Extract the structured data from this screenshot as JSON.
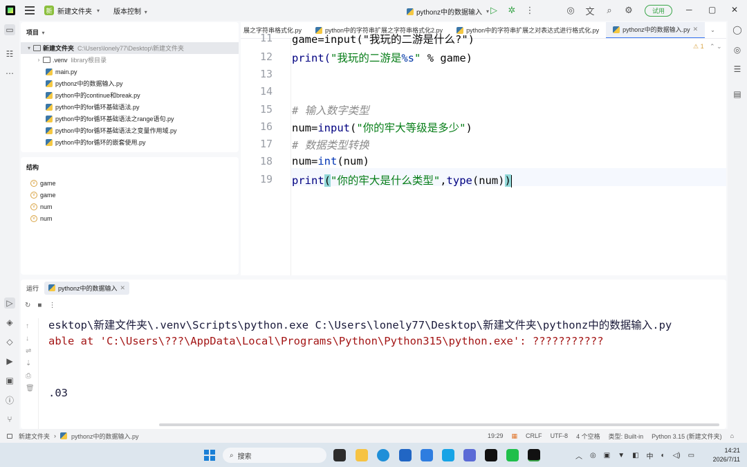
{
  "titlebar": {
    "project_name": "新建文件夹",
    "vcs_label": "版本控制",
    "run_config": "pythonz中的数据输入",
    "trial_label": "试用"
  },
  "project_panel": {
    "title": "项目",
    "root": {
      "name": "新建文件夹",
      "path": "C:\\Users\\lonely77\\Desktop\\新建文件夹"
    },
    "items": [
      {
        "name": ".venv",
        "note": "library根目录",
        "type": "folder"
      },
      {
        "name": "main.py",
        "type": "file"
      },
      {
        "name": "pythonz中的数据输入.py",
        "type": "file"
      },
      {
        "name": "python中的continue和break.py",
        "type": "file"
      },
      {
        "name": "python中的for循环基础语法.py",
        "type": "file"
      },
      {
        "name": "python中的for循环基础语法之range语句.py",
        "type": "file"
      },
      {
        "name": "python中的for循环基础语法之变量作用域.py",
        "type": "file"
      },
      {
        "name": "python中的for循环的嵌套使用.py",
        "type": "file"
      }
    ]
  },
  "structure_panel": {
    "title": "结构",
    "items": [
      "game",
      "game",
      "num",
      "num"
    ]
  },
  "editor": {
    "tabs": [
      "展之字符串格式化.py",
      "python中的字符串扩展之字符串格式化2.py",
      "python中的字符串扩展之对表达式进行格式化.py",
      "pythonz中的数据输入.py"
    ],
    "warning_count": "1",
    "line_numbers": [
      "11",
      "12",
      "13",
      "14",
      "15",
      "16",
      "17",
      "18",
      "19"
    ],
    "code": {
      "l11": "game=input(\"我玩的二游是什么?\")",
      "l12_a": "print(",
      "l12_b": "\"我玩的二游是",
      "l12_c": "%s",
      "l12_d": "\"",
      "l12_e": " % game)",
      "l15": "# 输入数字类型",
      "l16_a": "num=",
      "l16_b": "input",
      "l16_c": "(",
      "l16_d": "\"你的牢大等级是多少\"",
      "l16_e": ")",
      "l17": "# 数据类型转换",
      "l18_a": "num=",
      "l18_b": "int",
      "l18_c": "(num)",
      "l19_a": "print",
      "l19_b": "(",
      "l19_c": "\"你的牢大是什么类型\"",
      "l19_d": ",",
      "l19_e": "type",
      "l19_f": "(num)",
      "l19_g": ")"
    }
  },
  "run_panel": {
    "label": "运行",
    "tab": "pythonz中的数据输入",
    "output": [
      {
        "text": "esktop\\新建文件夹\\.venv\\Scripts\\python.exe C:\\Users\\lonely77\\Desktop\\新建文件夹\\pythonz中的数据输入.py",
        "kind": "normal"
      },
      {
        "text": "able at 'C:\\Users\\???\\AppData\\Local\\Programs\\Python\\Python315\\python.exe': ???????????",
        "kind": "error"
      },
      {
        "text": ".03",
        "kind": "normal"
      }
    ]
  },
  "statusbar": {
    "breadcrumb_root": "新建文件夹",
    "breadcrumb_file": "pythonz中的数据输入.py",
    "position": "19:29",
    "line_sep": "CRLF",
    "encoding": "UTF-8",
    "indent": "4 个空格",
    "type": "类型: Built-in",
    "interpreter": "Python 3.15 (新建文件夹)"
  },
  "taskbar": {
    "search_placeholder": "搜索",
    "ime": "中",
    "time": "14:21",
    "date": "2026/7/11"
  }
}
